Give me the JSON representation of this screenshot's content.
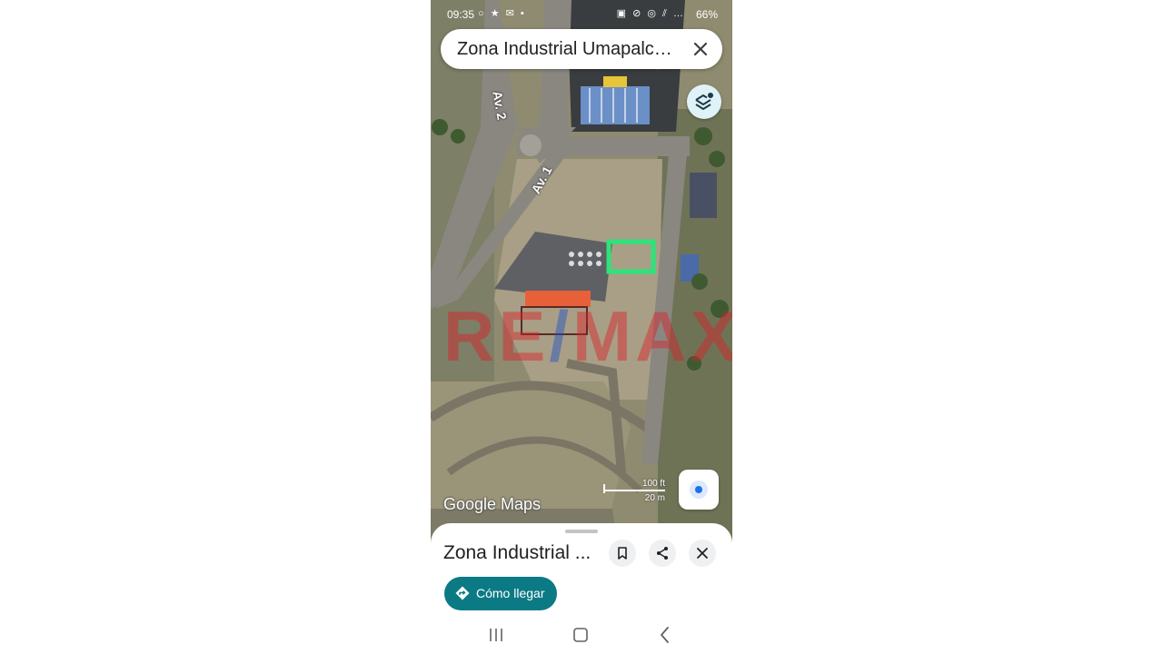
{
  "status_bar": {
    "time": "09:35",
    "left_icons": "○ ★ ✉ •",
    "right_icons": "▣ ⊘ ◎ ⫽ …",
    "battery": "66%"
  },
  "search": {
    "query": "Zona Industrial Umapalca, A...",
    "close_icon": "close-icon"
  },
  "map": {
    "road_labels": [
      "Av. 2",
      "Av. 1"
    ],
    "watermark_left": "RE",
    "watermark_mid": "/",
    "watermark_right": "MAX",
    "attribution": "Google Maps",
    "scale_ft": "100 ft",
    "scale_m": "20 m",
    "highlight_color": "#2de37a",
    "layers_icon": "layers-icon",
    "location_icon": "my-location-icon"
  },
  "place_sheet": {
    "title": "Zona Industrial ...",
    "save_icon": "bookmark-icon",
    "share_icon": "share-icon",
    "close_icon": "close-icon",
    "directions_label": "Cómo llegar",
    "directions_color": "#0b7a85"
  },
  "nav_bar": {
    "recent_icon": "recent-apps-icon",
    "home_icon": "home-icon",
    "back_icon": "back-icon"
  }
}
